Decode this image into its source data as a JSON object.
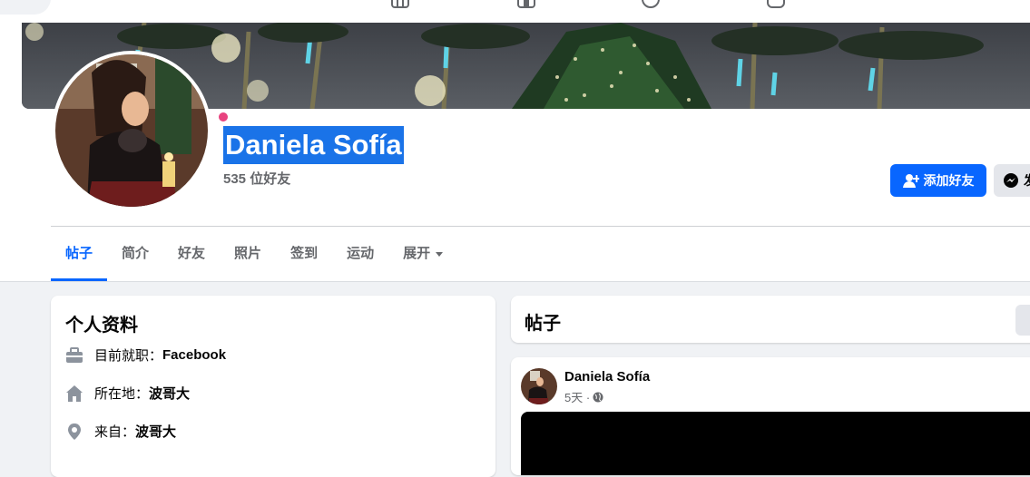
{
  "profile": {
    "name": "Daniela Sofía",
    "friend_count": "535 位好友",
    "add_friend_label": "添加好友",
    "message_label": "发"
  },
  "tabs": [
    {
      "label": "帖子",
      "active": true
    },
    {
      "label": "简介"
    },
    {
      "label": "好友"
    },
    {
      "label": "照片"
    },
    {
      "label": "签到"
    },
    {
      "label": "运动"
    },
    {
      "label": "展开"
    }
  ],
  "intro": {
    "title": "个人资料",
    "work_prefix": "目前就职：",
    "work_value": "Facebook",
    "lives_prefix": "所在地：",
    "lives_value": "波哥大",
    "from_prefix": "来自：",
    "from_value": "波哥大"
  },
  "posts": {
    "title": "帖子",
    "post_author": "Daniela Sofía",
    "post_time": "5天 ·"
  },
  "colors": {
    "accent": "#0866ff",
    "selection": "#1a73e8",
    "online_dot": "#e8437f",
    "secondary_text": "#65676b"
  }
}
